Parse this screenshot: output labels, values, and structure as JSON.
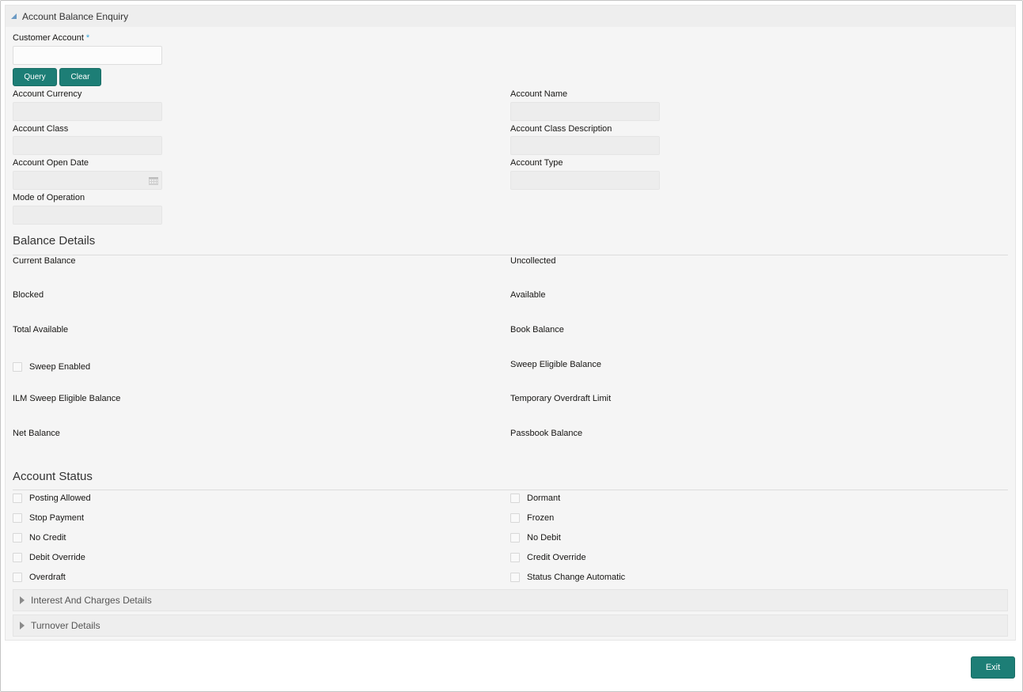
{
  "panel": {
    "title": "Account Balance Enquiry"
  },
  "customer_account": {
    "label": "Customer Account",
    "required_marker": "*",
    "value": "",
    "placeholder": ""
  },
  "buttons": {
    "query": "Query",
    "clear": "Clear",
    "exit": "Exit"
  },
  "account_fields": {
    "left": [
      {
        "label": "Account Currency",
        "value": ""
      },
      {
        "label": "Account Class",
        "value": ""
      },
      {
        "label": "Account Open Date",
        "value": "",
        "icon": "calendar-icon"
      },
      {
        "label": "Mode of Operation",
        "value": ""
      }
    ],
    "right": [
      {
        "label": "Account Name",
        "value": ""
      },
      {
        "label": "Account Class Description",
        "value": ""
      },
      {
        "label": "Account Type",
        "value": ""
      }
    ]
  },
  "balance_details": {
    "title": "Balance Details",
    "left": [
      {
        "label": "Current Balance",
        "value": ""
      },
      {
        "label": "Blocked",
        "value": ""
      },
      {
        "label": "Total Available",
        "value": ""
      },
      {
        "label": "Sweep Enabled",
        "type": "checkbox",
        "checked": false
      },
      {
        "label": "ILM Sweep Eligible Balance",
        "value": ""
      },
      {
        "label": "Net Balance",
        "value": ""
      }
    ],
    "right": [
      {
        "label": "Uncollected",
        "value": ""
      },
      {
        "label": "Available",
        "value": ""
      },
      {
        "label": "Book Balance",
        "value": ""
      },
      {
        "label": "Sweep Eligible Balance",
        "value": ""
      },
      {
        "label": "Temporary Overdraft Limit",
        "value": ""
      },
      {
        "label": "Passbook Balance",
        "value": ""
      }
    ]
  },
  "account_status": {
    "title": "Account Status",
    "left": [
      {
        "label": "Posting Allowed",
        "checked": false
      },
      {
        "label": "Stop Payment",
        "checked": false
      },
      {
        "label": "No Credit",
        "checked": false
      },
      {
        "label": "Debit Override",
        "checked": false
      },
      {
        "label": "Overdraft",
        "checked": false
      }
    ],
    "right": [
      {
        "label": "Dormant",
        "checked": false
      },
      {
        "label": "Frozen",
        "checked": false
      },
      {
        "label": "No Debit",
        "checked": false
      },
      {
        "label": "Credit Override",
        "checked": false
      },
      {
        "label": "Status Change Automatic",
        "checked": false
      }
    ]
  },
  "collapsibles": [
    {
      "label": "Interest And Charges Details",
      "expanded": false
    },
    {
      "label": "Turnover Details",
      "expanded": false
    }
  ],
  "colors": {
    "primary_button": "#1d7e76",
    "required_marker": "#36a2d6",
    "panel_bg": "#f5f5f5",
    "readonly_field_bg": "#ededed"
  }
}
